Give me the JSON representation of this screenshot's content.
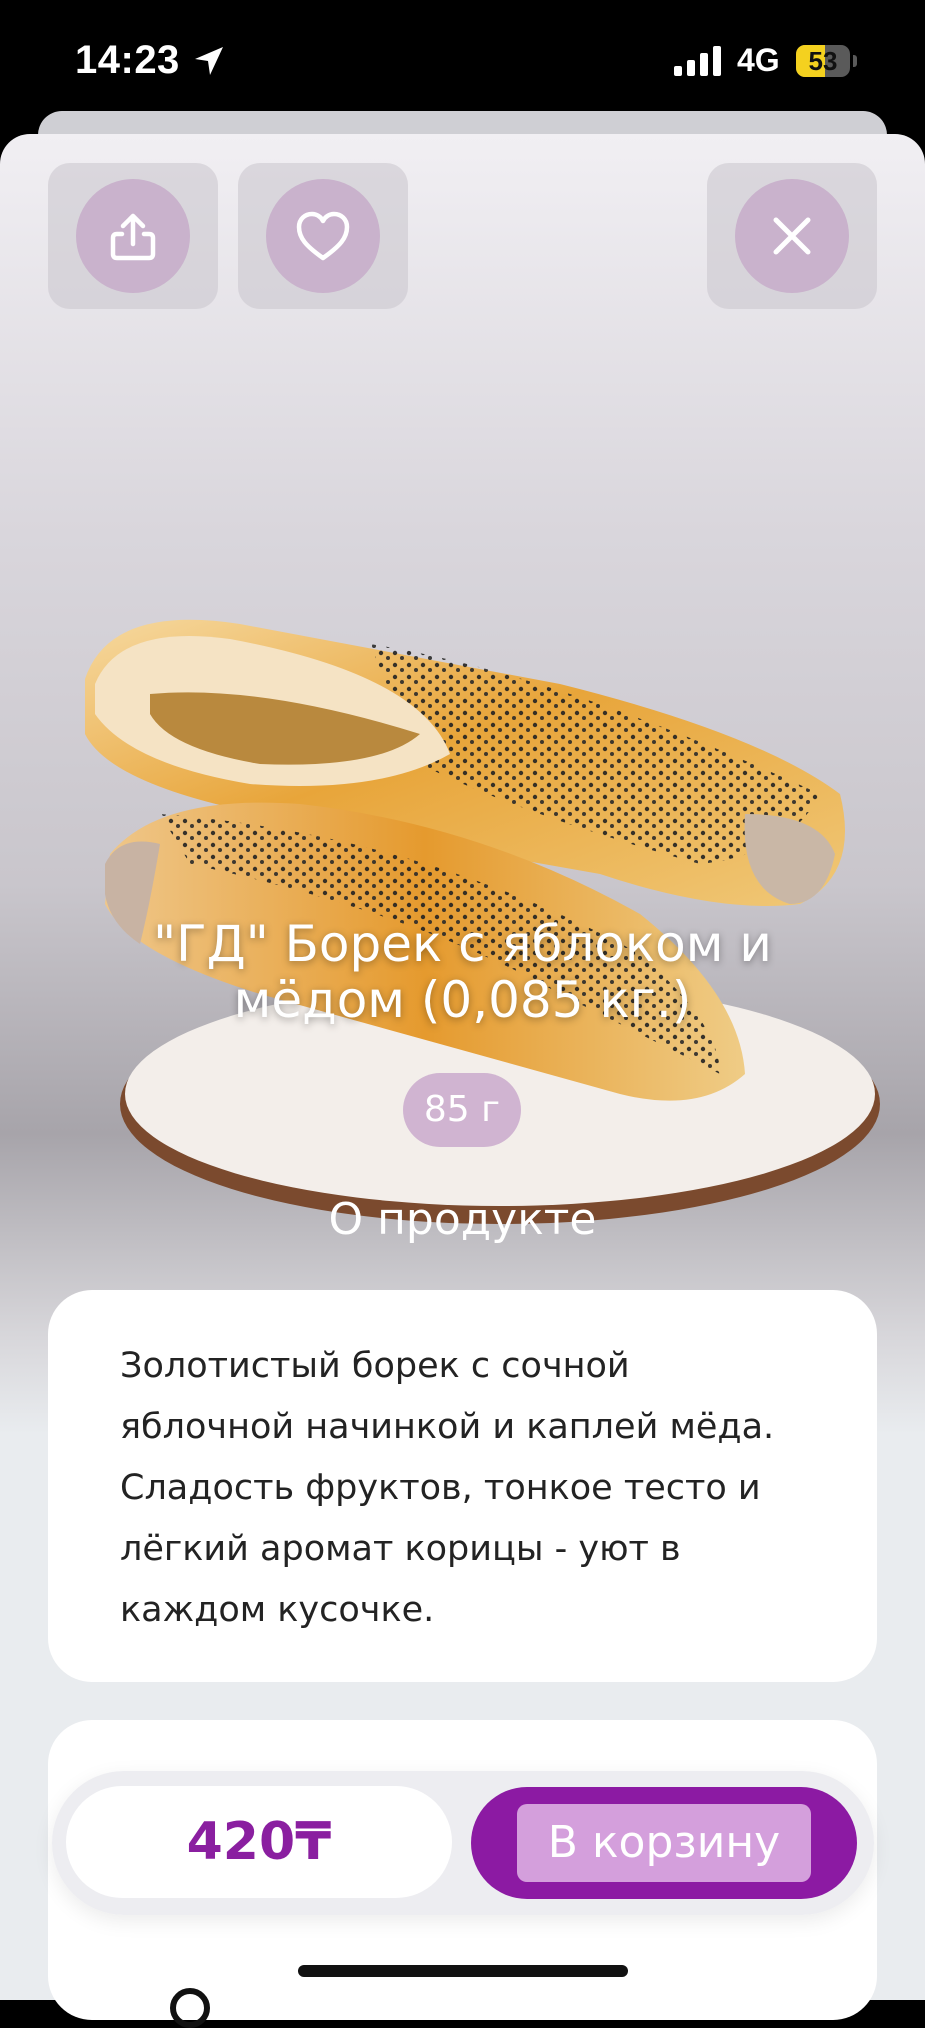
{
  "status_bar": {
    "time": "14:23",
    "network": "4G",
    "battery": "53",
    "battery_level": 0.53,
    "icons": [
      "location-arrow-icon",
      "cellular-signal-icon",
      "battery-icon"
    ]
  },
  "actions": {
    "share_icon": "share-icon",
    "favorite_icon": "heart-icon",
    "close_icon": "close-icon"
  },
  "product": {
    "title": "\"ГД\" Борек с яблоком и мёдом (0,085 кг.)",
    "weight": "85 г",
    "section_title": "О продукте",
    "description": "Золотистый борек с сочной яблочной начинкой и каплей мёда. Сладость фруктов, тонкое тесто и лёгкий аромат корицы - уют в каждом кусочке."
  },
  "cart": {
    "price": "420₸",
    "add_label": "В корзину"
  },
  "colors": {
    "accent": "#8c1aa3",
    "price": "#8a1fa0",
    "button_inner": "#d49fdc",
    "action_circle": "#c9b2cc"
  }
}
